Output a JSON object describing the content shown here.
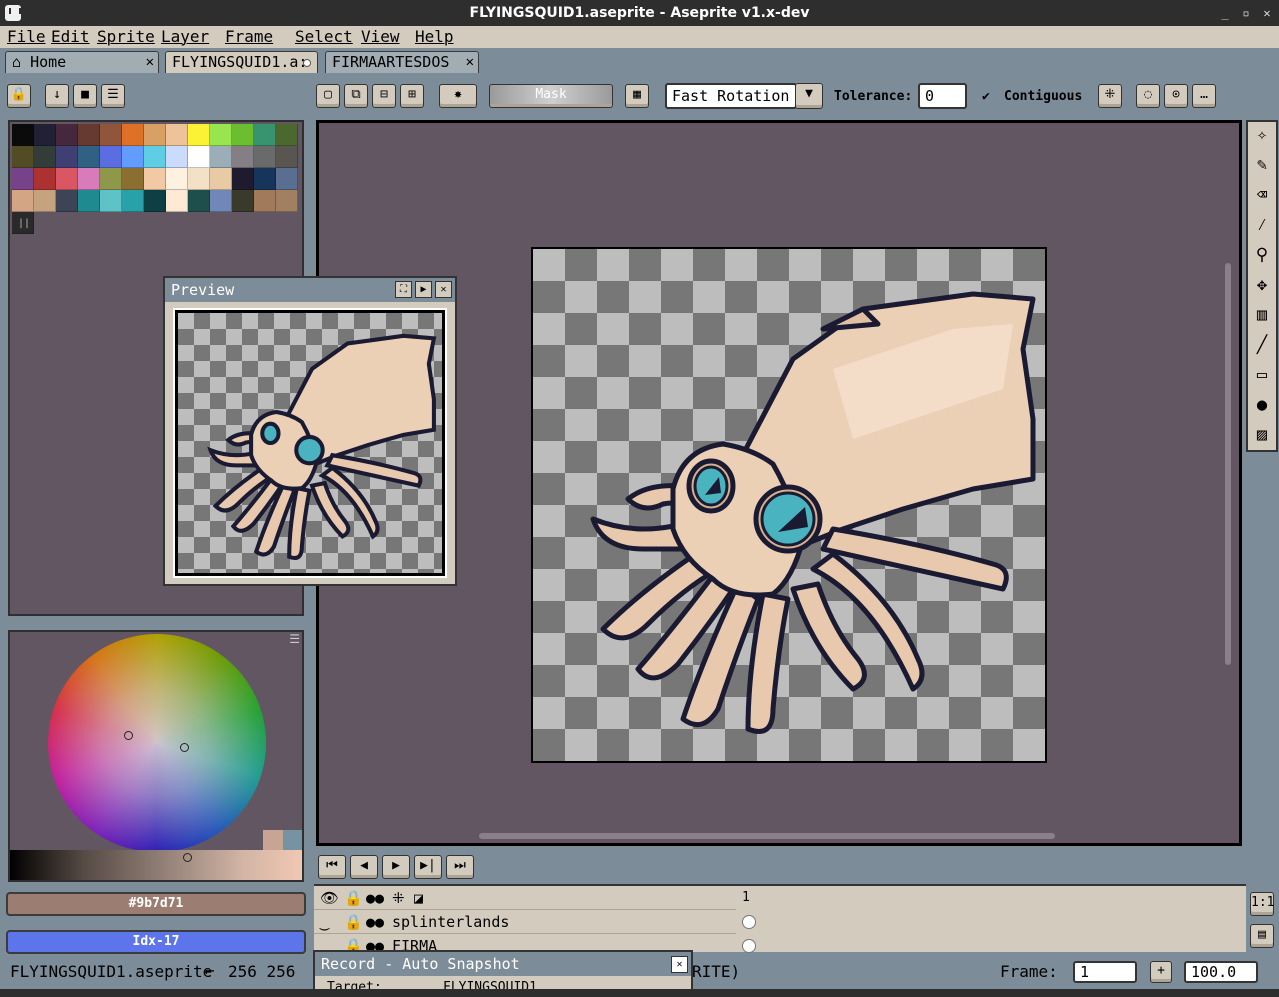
{
  "window": {
    "title": "FLYINGSQUID1.aseprite - Aseprite v1.x-dev",
    "controls": [
      "_",
      "▫",
      "✕"
    ]
  },
  "menu": [
    "File",
    "Edit",
    "Sprite",
    "Layer",
    "Frame",
    "Select",
    "View",
    "Help"
  ],
  "tabs": [
    {
      "label": "Home",
      "icon": "home-icon",
      "close": "✕"
    },
    {
      "label": "FLYINGSQUID1.a:",
      "active": true
    },
    {
      "label": "FIRMAARTESDOS",
      "close": "✕"
    }
  ],
  "toolbar": {
    "mask_label": "Mask",
    "rotation_algorithm": "Fast Rotation",
    "tolerance_label": "Tolerance:",
    "tolerance_value": "0",
    "contiguous_label": "Contiguous",
    "contiguous_checked": true
  },
  "palette": {
    "colors": [
      "#0b0b0b",
      "#222034",
      "#45283c",
      "#663931",
      "#8f563b",
      "#df7126",
      "#d9a066",
      "#eec39a",
      "#fbf236",
      "#99e550",
      "#6abe30",
      "#37946e",
      "#4b692f",
      "#524b24",
      "#323c39",
      "#3f3f74",
      "#306082",
      "#5b6ee1",
      "#639bff",
      "#5fcde4",
      "#cbdbfc",
      "#ffffff",
      "#9badb7",
      "#847e87",
      "#696a6a",
      "#595652",
      "#76428a",
      "#ac3232",
      "#d95763",
      "#d77bba",
      "#8f974a",
      "#8a6f30",
      "#f1c9a5",
      "#fff1e0",
      "#f3e1c7",
      "#e8cba5",
      "#1f1b2f",
      "#17355b",
      "#5a6e90",
      "#d4a584",
      "#c6a37f",
      "#3d4455",
      "#1f8a8f",
      "#5fc2c7",
      "#29a1a8",
      "#0e3f42",
      "#fde9d4",
      "#1f4f4c",
      "#7087b8",
      "#3a3a2a",
      "#a07a5b",
      "#a17f61",
      "#2a2a2a"
    ]
  },
  "preview": {
    "title": "Preview"
  },
  "colors": {
    "foreground": "#9b7d71",
    "background_label": "Idx-17",
    "background": "#5d75ea"
  },
  "timeline": {
    "frame_number": "1",
    "layers": [
      {
        "name": "splinterlands"
      },
      {
        "name": "FIRMA"
      }
    ]
  },
  "status": {
    "filename": "FLYINGSQUID1.aseprite",
    "size": "256 256",
    "partial": "RITE)",
    "frame_label": "Frame:",
    "frame_value": "1",
    "zoom": "100.0"
  },
  "snapshot": {
    "title": "Record - Auto Snapshot",
    "target_label": "Target:",
    "target_value": "FLYINGSQUID1"
  }
}
